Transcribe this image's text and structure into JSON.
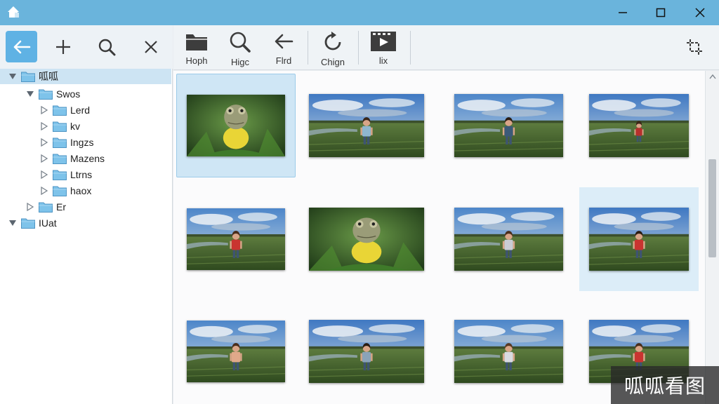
{
  "window": {
    "icons": {
      "app": "home-icon",
      "minimize": "minimize-icon",
      "maximize": "maximize-icon",
      "close": "close-icon"
    }
  },
  "left_toolbar": {
    "buttons": [
      {
        "icon": "back-arrow-icon",
        "active": true
      },
      {
        "icon": "plus-icon"
      },
      {
        "icon": "magnifier-icon"
      },
      {
        "icon": "close-x-icon"
      }
    ],
    "accent": "#5fb2e4"
  },
  "tree": {
    "items": [
      {
        "label": "呱呱",
        "level": 0,
        "expanded": true,
        "selected": true
      },
      {
        "label": "Swos",
        "level": 1,
        "expanded": true
      },
      {
        "label": "Lerd",
        "level": 2,
        "expanded": false
      },
      {
        "label": "kv",
        "level": 2,
        "expanded": false
      },
      {
        "label": "Ingzs",
        "level": 2,
        "expanded": false
      },
      {
        "label": "Mazens",
        "level": 2,
        "expanded": false
      },
      {
        "label": "Ltrns",
        "level": 2,
        "expanded": false
      },
      {
        "label": "haox",
        "level": 2,
        "expanded": false
      },
      {
        "label": "Er",
        "level": 1,
        "expanded": false
      },
      {
        "label": "IUat",
        "level": 0,
        "expanded": true
      }
    ]
  },
  "toolbar": {
    "buttons": [
      {
        "label": "Hoph",
        "icon": "folder-icon"
      },
      {
        "label": "Higc",
        "icon": "magnifier-icon"
      },
      {
        "label": "Flrd",
        "icon": "arrow-left-icon"
      },
      {
        "label": "Chign",
        "icon": "rotate-icon"
      },
      {
        "label": "lix",
        "icon": "video-icon"
      }
    ],
    "crop_icon": "crop-icon"
  },
  "gallery": {
    "items": [
      {
        "subject": "frog",
        "shirt": "#e9d536",
        "selected": true
      },
      {
        "subject": "child",
        "shirt": "#8fb7cf",
        "hair": "#3a2618"
      },
      {
        "subject": "child",
        "shirt": "#3c5a78",
        "hair": "#2a1c12"
      },
      {
        "subject": "child",
        "shirt": "#b8302d",
        "hair": "#3a2618",
        "small": true
      },
      {
        "subject": "child",
        "shirt": "#c93430",
        "hair": "#4a2e1c"
      },
      {
        "subject": "frog",
        "shirt": "#e9d536"
      },
      {
        "subject": "child",
        "shirt": "#c9ccd6",
        "hair": "#4a2e1c"
      },
      {
        "subject": "child",
        "shirt": "#c93430",
        "hair": "#2a1c12",
        "hover": true
      },
      {
        "subject": "child",
        "shirt": "#e0a98a",
        "hair": "#4a2e1c"
      },
      {
        "subject": "child",
        "shirt": "#8aa3b8",
        "hair": "#2a1c12"
      },
      {
        "subject": "child",
        "shirt": "#d9dbe2",
        "hair": "#5a3a24"
      },
      {
        "subject": "child",
        "shirt": "#c93430",
        "hair": "#4a2e1c"
      }
    ]
  },
  "watermark": "呱呱看图"
}
